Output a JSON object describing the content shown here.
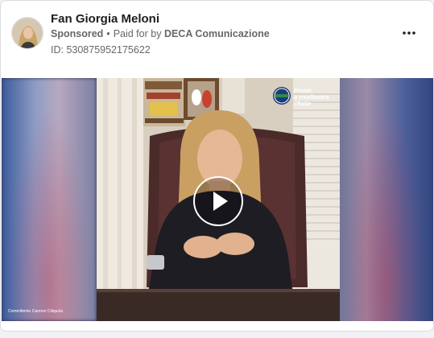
{
  "ad": {
    "page_name": "Fan Giorgia Meloni",
    "sponsored_label": "Sponsored",
    "separator": "•",
    "paid_for_prefix": "Paid for by",
    "payer": "DECA Comunicazione",
    "id_text": "ID: 530875952175622"
  },
  "video": {
    "badge_lines": [
      "Pronti",
      "a risollevare",
      "l'Italia"
    ],
    "badge_logo_text": "MELONI",
    "caption": "Committente Carmen Ciliquola"
  },
  "icons": {
    "more": "more-options-icon",
    "play": "play-icon"
  },
  "colors": {
    "card_bg": "#ffffff",
    "text_primary": "#1c1e21",
    "text_secondary": "#65676b"
  }
}
